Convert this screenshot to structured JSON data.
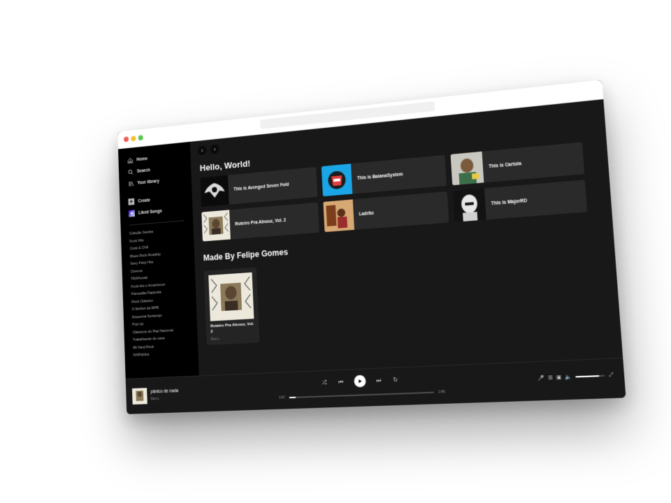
{
  "sidebar": {
    "nav": [
      {
        "label": "Home",
        "icon": "home-icon"
      },
      {
        "label": "Search",
        "icon": "search-icon"
      },
      {
        "label": "Your library",
        "icon": "library-icon"
      }
    ],
    "create_label": "Create",
    "liked_label": "Liked Songs",
    "playlists": [
      "Coleção Samba",
      "Funk Hits",
      "Cook & Chill",
      "Blues Rock Roadtrip",
      "Sexy Party Hits",
      "Cinema",
      "TRAPenski",
      "Funk Até o Amanhecer",
      "Pancadão Paplovila",
      "Rock Clássico",
      "O Melhor da MPB",
      "Esquenta Sertanejo",
      "Pop Up",
      "Clássicos do Rap Nacional",
      "Trabalhando de casa",
      "80 Hard Rock",
      "RAPública"
    ]
  },
  "main": {
    "greeting": "Hello, World!",
    "quick_cards": [
      {
        "title": "This is Avenged Seven Fold",
        "art_bg": "#0b0b0b"
      },
      {
        "title": "This is BaianaSystem",
        "art_bg": "#1aa6e6"
      },
      {
        "title": "This is Cartola",
        "art_bg": "#4a7c5a"
      },
      {
        "title": "Roteiro Pra Aïnouz, Vol. 2",
        "art_bg": "#ece8dc"
      },
      {
        "title": "Ladrão",
        "art_bg": "#b07a3e"
      },
      {
        "title": "This is MajorRD",
        "art_bg": "#121212"
      }
    ],
    "section_title": "Made By Felipe Gomes",
    "album": {
      "title": "Roteiro Pra Aïnouz, Vol. 2",
      "artist": "Don L"
    }
  },
  "player": {
    "track_title": "pânico de nada",
    "track_artist": "Don L",
    "elapsed": "0:07",
    "duration": "2:46",
    "progress_fraction": 0.05,
    "volume_fraction": 0.8
  },
  "colors": {
    "background": "#121212",
    "sidebar": "#000000",
    "card": "#2a2a2a",
    "text": "#ffffff",
    "muted": "#b3b3b3"
  }
}
